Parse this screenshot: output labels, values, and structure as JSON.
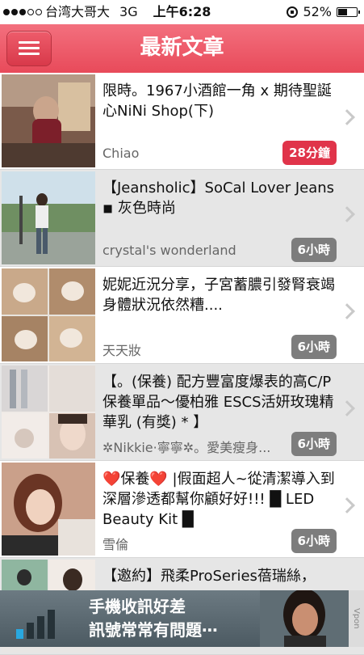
{
  "status_bar": {
    "carrier": "台湾大哥大",
    "network": "3G",
    "time": "上午6:28",
    "battery": "52%",
    "battery_level": 0.52
  },
  "header": {
    "title": "最新文章",
    "menu_icon": "hamburger-icon"
  },
  "articles": [
    {
      "title": "限時。1967小酒館一角 x 期待聖誕心NiNi Shop(下)",
      "author": "Chiao",
      "time": "28分鐘",
      "highlight": true
    },
    {
      "title": "【Jeansholic】SoCal Lover Jeans ◾ 灰色時尚",
      "author": "crystal's wonderland",
      "time": "6小時",
      "highlight": false
    },
    {
      "title": "妮妮近況分享，子宮蓄膿引發腎衰竭身體狀況依然糟....",
      "author": "天天妝",
      "time": "6小時",
      "highlight": false
    },
    {
      "title": "【。(保養) 配方豐富度爆表的高C/P保養單品～優柏雅 ESCS活妍玫瑰精華乳 (有獎) * 】",
      "author": "✲Nikkie·寧寧✲。愛美瘦身...",
      "time": "6小時",
      "highlight": false
    },
    {
      "title": "❤️保養❤️ |假面超人~從清潔導入到深層滲透都幫你顧好好!!! █ LED Beauty Kit █",
      "author": "雪倫",
      "time": "6小時",
      "highlight": false
    },
    {
      "title": "【邀約】飛柔ProSeries蓓瑞絲，",
      "author": "",
      "time": "",
      "highlight": false
    }
  ],
  "ad": {
    "line1": "手機收訊好差",
    "line2": "訊號常常有問題⋯",
    "brand": "Vpon"
  },
  "colors": {
    "header": "#e84a5a",
    "badge_new": "#e0344a",
    "badge_old": "#7d7d7d"
  }
}
